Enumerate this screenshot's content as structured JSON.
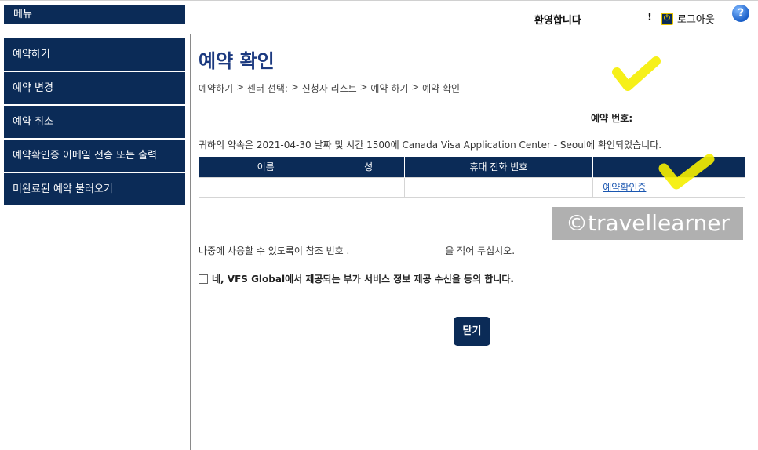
{
  "menu": {
    "title": "메뉴"
  },
  "header": {
    "welcome": "환영합니다",
    "exclamation": "!",
    "logout_label": "로그아웃",
    "help_symbol": "?"
  },
  "sidebar": {
    "items": [
      {
        "label": "예약하기"
      },
      {
        "label": "예약 변경"
      },
      {
        "label": "예약 취소"
      },
      {
        "label": "예약확인증 이메일 전송 또는 출력"
      },
      {
        "label": "미완료된 예약 불러오기"
      }
    ]
  },
  "main": {
    "title": "예약 확인",
    "breadcrumb": [
      "예약하기",
      "센터 선택:",
      "신청자 리스트",
      "예약 하기",
      "예약 확인"
    ],
    "breadcrumb_separator": ">",
    "booking_number_label": "예약 번호:",
    "confirmation_text": "귀하의 약속은 2021-04-30 날짜 및 시간 1500에 Canada Visa Application Center - Seoul에 확인되었습니다.",
    "table": {
      "headers": [
        "이름",
        "성",
        "휴대 전화 번호",
        ""
      ],
      "row_link": "예약확인증"
    },
    "reference_text_before": "나중에 사용할 수 있도록이 참조 번호 .",
    "reference_text_after": "을 적어 두십시오.",
    "consent_label": "네, VFS Global에서 제공되는 부가 서비스 정보 제공 수신을 동의 합니다.",
    "close_button": "닫기"
  },
  "watermark": "©travellearner",
  "colors": {
    "navy": "#0b2b57",
    "title_blue": "#1c3a80",
    "link_blue": "#1a56b0",
    "highlight": "#f5ee00"
  }
}
